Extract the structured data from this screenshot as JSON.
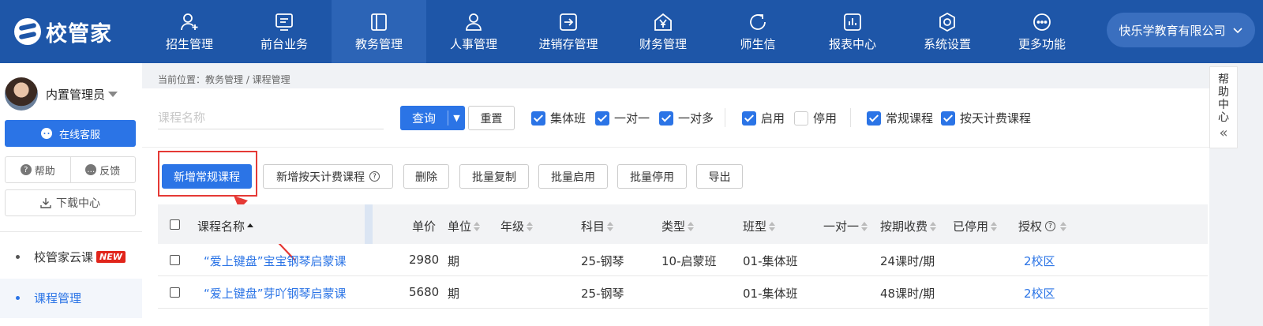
{
  "app": {
    "logo_text": "校管家"
  },
  "nav": [
    {
      "label": "招生管理",
      "icon": "user-plus-icon"
    },
    {
      "label": "前台业务",
      "icon": "monitor-icon"
    },
    {
      "label": "教务管理",
      "icon": "book-icon",
      "active": true
    },
    {
      "label": "人事管理",
      "icon": "person-icon"
    },
    {
      "label": "进销存管理",
      "icon": "arrow-box-icon"
    },
    {
      "label": "财务管理",
      "icon": "yen-icon"
    },
    {
      "label": "师生信",
      "icon": "chat-icon"
    },
    {
      "label": "报表中心",
      "icon": "chart-icon"
    },
    {
      "label": "系统设置",
      "icon": "gear-icon"
    },
    {
      "label": "更多功能",
      "icon": "more-icon"
    }
  ],
  "company": "快乐学教育有限公司",
  "sidebar": {
    "username": "内置管理员",
    "service": "在线客服",
    "help": "帮助",
    "feedback": "反馈",
    "download": "下载中心",
    "links": [
      {
        "label": "校管家云课",
        "badge": "NEW"
      },
      {
        "label": "课程管理",
        "active": true
      }
    ]
  },
  "breadcrumb": "当前位置：教务管理 / 课程管理",
  "filters": {
    "search_placeholder": "课程名称",
    "query": "查询",
    "reset": "重置",
    "class_types": [
      {
        "label": "集体班",
        "checked": true
      },
      {
        "label": "一对一",
        "checked": true
      },
      {
        "label": "一对多",
        "checked": true
      }
    ],
    "status": [
      {
        "label": "启用",
        "checked": true
      },
      {
        "label": "停用",
        "checked": false
      }
    ],
    "course_kinds": [
      {
        "label": "常规课程",
        "checked": true
      },
      {
        "label": "按天计费课程",
        "checked": true
      }
    ]
  },
  "toolbar": {
    "add_regular": "新增常规课程",
    "add_daily": "新增按天计费课程",
    "delete": "删除",
    "batch_copy": "批量复制",
    "batch_enable": "批量启用",
    "batch_disable": "批量停用",
    "export": "导出"
  },
  "table": {
    "headers": {
      "name": "课程名称",
      "price": "单价",
      "unit": "单位",
      "grade": "年级",
      "subject": "科目",
      "type": "类型",
      "class_type": "班型",
      "one_on_one": "一对一",
      "billing": "按期收费",
      "disabled": "已停用",
      "auth": "授权"
    },
    "rows": [
      {
        "name": "“爱上键盘”宝宝钢琴启蒙课",
        "price": "2980",
        "unit": "期",
        "grade": "",
        "subject": "25-钢琴",
        "type": "10-启蒙班",
        "class_type": "01-集体班",
        "billing": "24课时/期",
        "auth": "2校区"
      },
      {
        "name": "“爱上键盘”芽吖钢琴启蒙课",
        "price": "5680",
        "unit": "期",
        "grade": "",
        "subject": "25-钢琴",
        "type": "",
        "class_type": "01-集体班",
        "billing": "48课时/期",
        "auth": "2校区"
      }
    ]
  },
  "help_center": [
    "帮",
    "助",
    "中",
    "心"
  ],
  "colors": {
    "topbar": "#1e56a8",
    "primary": "#2b74e6",
    "highlight": "#e53935"
  }
}
